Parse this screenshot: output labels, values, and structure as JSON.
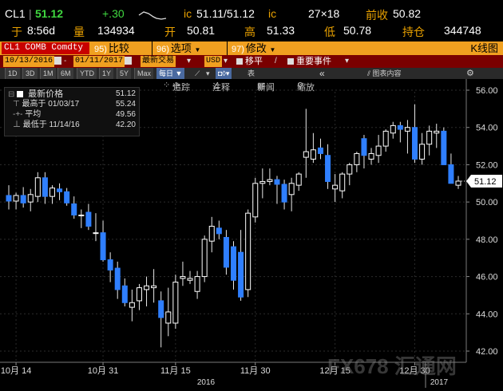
{
  "quote": {
    "ticker": "CL1",
    "last": "51.12",
    "change": "+.30",
    "bidask_label": "ic",
    "bidask": "51.11/51.12",
    "bidask_suffix": "ic",
    "size": "27×18",
    "prev_label": "前收",
    "prev": "50.82",
    "time_label": "于",
    "time": "8:56d",
    "volume_label": "量",
    "volume": "134934",
    "open_label": "开",
    "open": "50.81",
    "high_label": "高",
    "high": "51.33",
    "low_label": "低",
    "low": "50.78",
    "oi_label": "持仓",
    "oi": "344748"
  },
  "function_bar": {
    "security": "CL1 COMB Comdty",
    "compare_num": "95)",
    "compare": "比较",
    "options_num": "96)",
    "options": "选项",
    "edit_num": "97)",
    "edit": "修改",
    "title": "K线图"
  },
  "date_bar": {
    "start": "10/13/2016",
    "end": "01/11/2017",
    "mode": "最新交易",
    "currency": "USD",
    "moving_avg": "移平",
    "key_events": "重要事件"
  },
  "toolbar": {
    "ranges": [
      "1D",
      "3D",
      "1M",
      "6M",
      "YTD",
      "1Y",
      "5Y",
      "Max"
    ],
    "period": "每日",
    "table_label": "表",
    "chart_content": "图表内容"
  },
  "chart_tools": {
    "track": "追踪",
    "annotate": "注释",
    "news": "新闻",
    "zoom": "缩放"
  },
  "legend": {
    "last_label": "最新价格",
    "last_value": "51.12",
    "high_label": "最高于 01/03/17",
    "high_value": "55.24",
    "avg_label": "平均",
    "avg_value": "49.56",
    "low_label": "最低于 11/14/16",
    "low_value": "42.20"
  },
  "watermark": "FX678 汇通网",
  "chart_data": {
    "type": "candlestick",
    "current_price_tag": "51.12",
    "y_ticks": [
      "56.00",
      "54.00",
      "52.00",
      "50.00",
      "48.00",
      "46.00",
      "44.00",
      "42.00"
    ],
    "ylim": [
      41.4,
      56.6
    ],
    "x_ticks": [
      "10月 14",
      "10月 31",
      "11月 15",
      "11月 30",
      "12月 15",
      "12月 30"
    ],
    "years": [
      "2016",
      "2017"
    ],
    "up_color": "#ffffff",
    "down_color": "#2f7fff",
    "candles": [
      [
        50.35,
        50.9,
        49.6,
        50.05
      ],
      [
        50.05,
        50.5,
        49.6,
        50.35
      ],
      [
        50.35,
        50.8,
        49.7,
        49.95
      ],
      [
        50.0,
        50.7,
        49.5,
        50.4
      ],
      [
        50.3,
        51.6,
        50.0,
        51.3
      ],
      [
        51.3,
        51.6,
        49.9,
        50.3
      ],
      [
        50.3,
        50.9,
        49.9,
        50.75
      ],
      [
        50.7,
        51.0,
        50.1,
        50.55
      ],
      [
        50.55,
        50.75,
        49.8,
        49.95
      ],
      [
        49.9,
        50.3,
        49.1,
        49.3
      ],
      [
        49.3,
        49.6,
        48.6,
        49.3
      ],
      [
        49.45,
        49.9,
        48.5,
        48.7
      ],
      [
        48.35,
        49.4,
        47.9,
        48.35
      ],
      [
        48.35,
        49.0,
        46.8,
        46.9
      ],
      [
        46.9,
        47.3,
        45.7,
        46.35
      ],
      [
        46.45,
        46.8,
        44.8,
        45.3
      ],
      [
        45.5,
        45.9,
        44.4,
        44.6
      ],
      [
        44.35,
        45.3,
        43.6,
        44.6
      ],
      [
        44.7,
        45.6,
        44.2,
        45.4
      ],
      [
        45.3,
        46.0,
        44.4,
        45.5
      ],
      [
        45.4,
        46.4,
        44.6,
        45.5
      ],
      [
        44.7,
        45.2,
        42.2,
        43.8
      ],
      [
        43.5,
        45.4,
        42.8,
        44.1
      ],
      [
        43.5,
        46.1,
        43.2,
        45.7
      ],
      [
        45.9,
        46.8,
        45.5,
        46.0
      ],
      [
        45.8,
        46.3,
        45.6,
        45.9
      ],
      [
        45.2,
        46.3,
        44.8,
        46.0
      ],
      [
        46.0,
        48.2,
        45.7,
        48.0
      ],
      [
        47.9,
        49.2,
        47.3,
        48.7
      ],
      [
        48.6,
        49.0,
        48.0,
        48.3
      ],
      [
        48.1,
        48.5,
        46.1,
        46.5
      ],
      [
        47.6,
        47.9,
        45.3,
        45.8
      ],
      [
        47.3,
        48.5,
        44.7,
        44.9
      ],
      [
        45.3,
        49.6,
        44.9,
        49.4
      ],
      [
        49.2,
        51.3,
        48.9,
        51.0
      ],
      [
        51.0,
        51.8,
        50.2,
        51.1
      ],
      [
        51.1,
        51.8,
        50.9,
        51.2
      ],
      [
        51.2,
        51.4,
        49.9,
        50.95
      ],
      [
        50.95,
        51.2,
        49.6,
        50.0
      ],
      [
        50.4,
        51.3,
        49.5,
        51.0
      ],
      [
        50.9,
        51.6,
        50.6,
        51.5
      ],
      [
        52.4,
        55.0,
        51.3,
        52.7
      ],
      [
        52.3,
        53.7,
        52.1,
        52.8
      ],
      [
        52.9,
        53.4,
        52.3,
        52.6
      ],
      [
        52.5,
        53.1,
        50.7,
        51.1
      ],
      [
        50.7,
        51.5,
        50.0,
        50.9
      ],
      [
        50.6,
        51.6,
        50.2,
        51.5
      ],
      [
        51.5,
        52.1,
        50.9,
        52.0
      ],
      [
        52.0,
        52.7,
        51.6,
        52.6
      ],
      [
        53.4,
        53.6,
        51.8,
        52.5
      ],
      [
        52.3,
        52.9,
        52.0,
        52.6
      ],
      [
        52.5,
        53.6,
        52.1,
        53.0
      ],
      [
        53.0,
        53.9,
        52.7,
        53.8
      ],
      [
        53.7,
        54.3,
        53.4,
        54.1
      ],
      [
        54.1,
        54.3,
        53.2,
        53.9
      ],
      [
        53.8,
        54.4,
        52.6,
        54.0
      ],
      [
        54.0,
        55.24,
        52.1,
        52.3
      ],
      [
        52.3,
        53.7,
        52.0,
        53.1
      ],
      [
        53.1,
        54.1,
        52.5,
        53.8
      ],
      [
        53.7,
        54.2,
        52.9,
        53.8
      ],
      [
        53.8,
        54.0,
        52.3,
        52.0
      ],
      [
        52.0,
        52.6,
        51.0,
        51.0
      ],
      [
        50.9,
        51.4,
        50.7,
        51.12
      ]
    ]
  }
}
